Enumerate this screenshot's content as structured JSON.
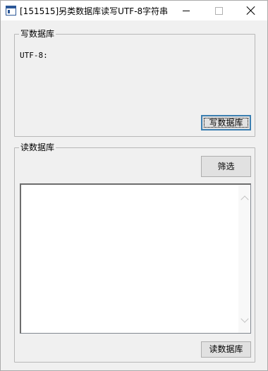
{
  "window": {
    "title": "[151515]另类数据库读写UTF-8字符串",
    "icon": "app-window-icon"
  },
  "title_bar_buttons": [
    "minimize",
    "maximize",
    "close"
  ],
  "write_group": {
    "legend": "写数据库",
    "utf8_label": "UTF-8:",
    "write_button": "写数据库"
  },
  "read_group": {
    "legend": "读数据库",
    "filter_button": "筛选",
    "read_button": "读数据库",
    "list_items": []
  }
}
